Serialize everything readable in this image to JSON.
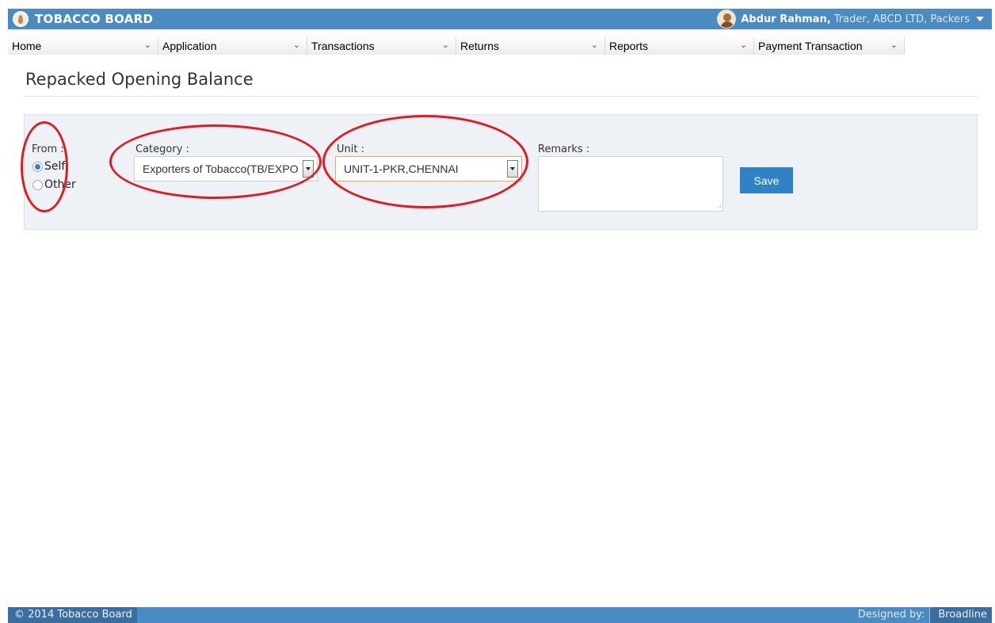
{
  "header": {
    "brand_title": "TOBACCO BOARD",
    "user_name": "Abdur Rahman,",
    "user_role": "Trader, ABCD LTD, Packers"
  },
  "menu": {
    "items": [
      {
        "label": "Home"
      },
      {
        "label": "Application"
      },
      {
        "label": "Transactions"
      },
      {
        "label": "Returns"
      },
      {
        "label": "Reports"
      },
      {
        "label": "Payment Transaction"
      }
    ]
  },
  "page": {
    "title": "Repacked Opening Balance"
  },
  "form": {
    "from_label": "From :",
    "from_options": [
      {
        "label": "Self",
        "checked": true
      },
      {
        "label": "Other",
        "checked": false
      }
    ],
    "category_label": "Category :",
    "category_value": "Exporters of Tobacco(TB/EXPO",
    "unit_label": "Unit :",
    "unit_value": "UNIT-1-PKR,CHENNAI",
    "remarks_label": "Remarks :",
    "remarks_value": "",
    "save_label": "Save"
  },
  "footer": {
    "copyright": "© 2014 Tobacco Board",
    "designed_by_label": "Designed by:",
    "designer": "Broadline"
  },
  "colors": {
    "header_blue": "#4a8bc2",
    "save_button": "#2f82c4",
    "annotation_red": "#e01b22",
    "menu_chevron": "#cc2222"
  },
  "icons": {
    "brand": "tobacco-leaf-icon",
    "user": "user-avatar-icon",
    "user_menu": "caret-down-icon",
    "menu": "chevron-down-icon"
  }
}
